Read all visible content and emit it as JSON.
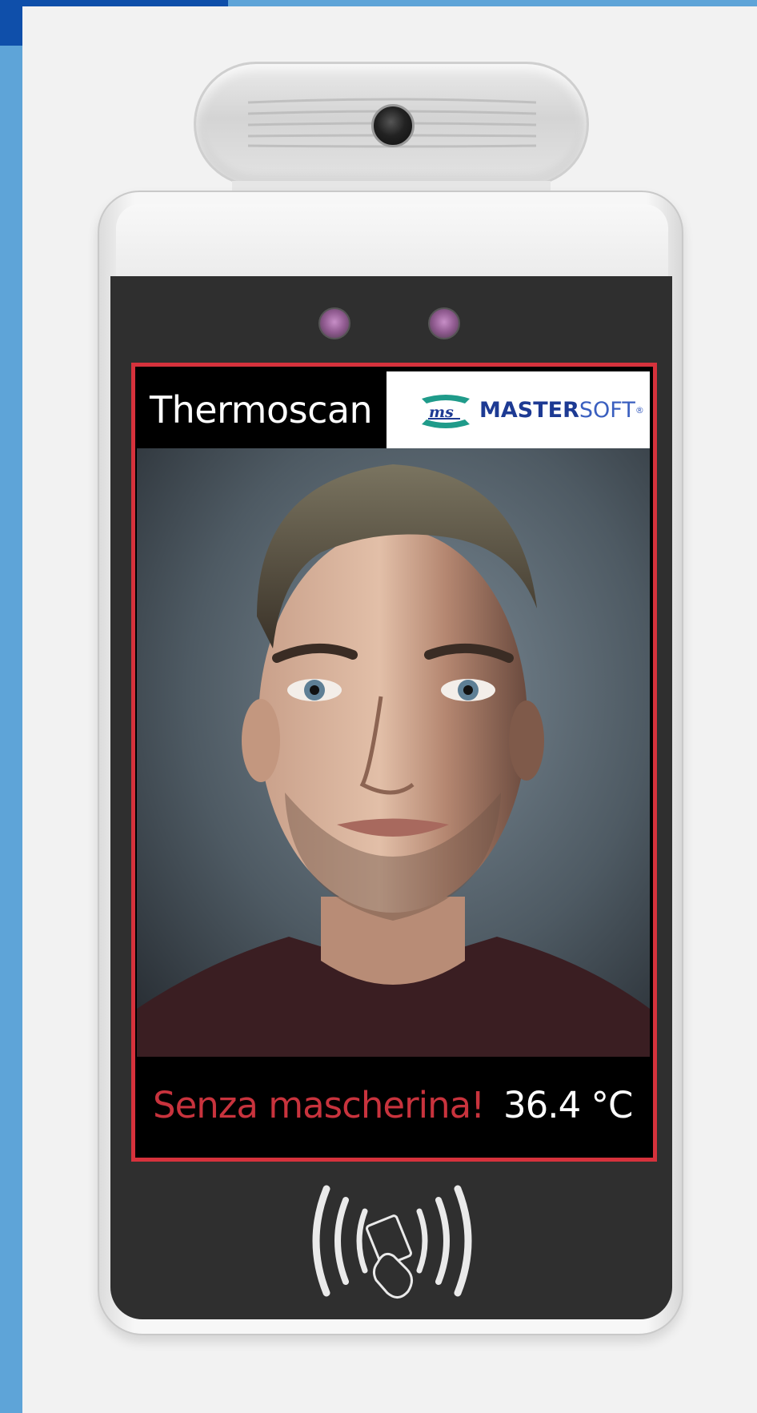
{
  "screen": {
    "title": "Thermoscan",
    "brand": {
      "mark": "ms",
      "name_bold": "MASTER",
      "name_light": "SOFT",
      "registered": "®"
    },
    "status": {
      "mask_warning": "Senza mascherina!",
      "temperature": "36.4 °C"
    }
  },
  "icons": {
    "camera": "camera-lens-icon",
    "infrared_sensors": "infrared-sensor-icon",
    "nfc": "contactless-card-icon"
  },
  "colors": {
    "accent_blue": "#5ea4d8",
    "dark_blue": "#0f4faa",
    "alert_red": "#d6323c",
    "warning_text": "#c8333d",
    "brand_blue": "#1d3a93"
  }
}
